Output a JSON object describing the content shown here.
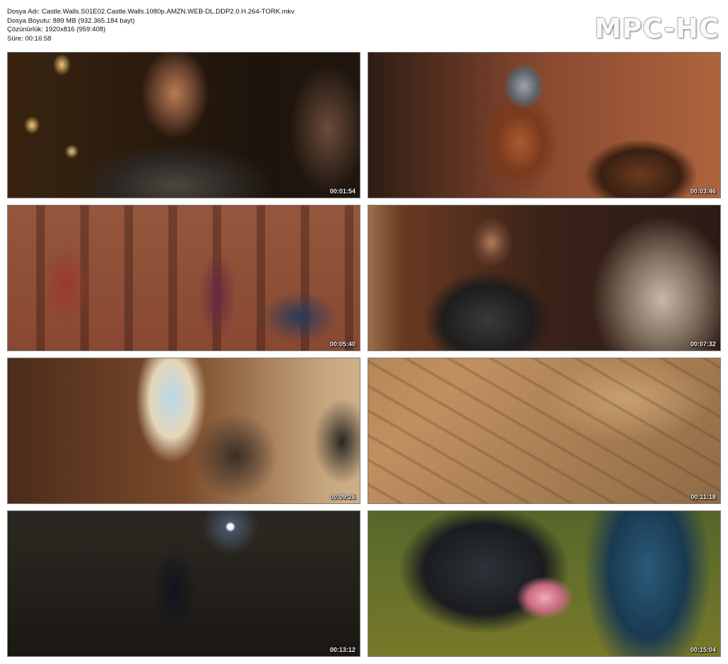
{
  "info": {
    "filename": "Dosya Adı: Castle.Walls.S01E02.Castle.Walls.1080p.AMZN.WEB-DL.DDP2.0.H.264-TORK.mkv",
    "filesize": "Dosya Boyutu: 889 MB (932.365.184 bayt)",
    "resolution": "Çözünürlük: 1920x816 (959:408)",
    "duration": "Süre: 00:16:58"
  },
  "brand": "MPC-HC",
  "thumbnails": [
    {
      "timestamp": "00:01:54",
      "scene": "armored-man-candlelit-hall"
    },
    {
      "timestamp": "00:03:46",
      "scene": "helmeted-knight-on-horse"
    },
    {
      "timestamp": "00:05:40",
      "scene": "ornate-throne-room"
    },
    {
      "timestamp": "00:07:32",
      "scene": "man-in-doorway-desert-town"
    },
    {
      "timestamp": "00:09:26",
      "scene": "riders-in-canyon"
    },
    {
      "timestamp": "00:11:18",
      "scene": "aerial-rooftop-fight"
    },
    {
      "timestamp": "00:13:12",
      "scene": "rider-under-full-moon"
    },
    {
      "timestamp": "00:15:04",
      "scene": "man-kneeling-by-flower"
    }
  ],
  "colors": {
    "background": "#ffffff",
    "brand_text": "#fafafa",
    "timestamp_text": "#f2f2f2"
  }
}
